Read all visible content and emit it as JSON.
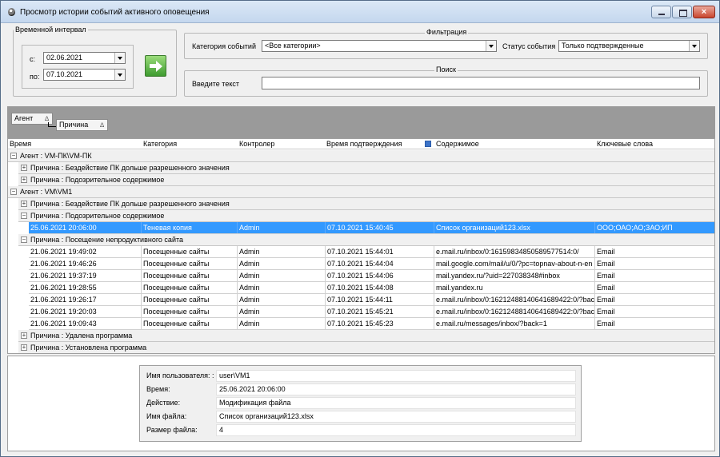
{
  "window": {
    "title": "Просмотр истории событий активного оповещения",
    "close_glyph": "×"
  },
  "interval": {
    "legend": "Временной интервал",
    "from_label": "с:",
    "from_value": "02.06.2021",
    "to_label": "по:",
    "to_value": "07.10.2021"
  },
  "filter": {
    "legend": "Фильтрация",
    "category_label": "Категория событий",
    "category_value": "<Все категории>",
    "status_label": "Статус события",
    "status_value": "Только подтвержденные"
  },
  "search": {
    "legend": "Поиск",
    "label": "Введите текст",
    "value": ""
  },
  "grouping": {
    "chips": [
      "Агент",
      "Причина"
    ],
    "sort_glyph": "∆"
  },
  "grid": {
    "columns": [
      "Время",
      "Категория",
      "Контролер",
      "Время подтверждения",
      "Содержимое",
      "Ключевые слова"
    ],
    "agents": [
      {
        "label": "Агент : VM-ПК\\VM-ПК",
        "reasons": [
          {
            "label": "Причина : Бездействие ПК дольше разрешенного значения",
            "expanded": false,
            "rows": []
          },
          {
            "label": "Причина : Подозрительное содержимое",
            "expanded": false,
            "rows": []
          }
        ]
      },
      {
        "label": "Агент : VM\\VM1",
        "reasons": [
          {
            "label": "Причина : Бездействие ПК дольше разрешенного значения",
            "expanded": false,
            "rows": []
          },
          {
            "label": "Причина : Подозрительное содержимое",
            "expanded": true,
            "rows": [
              {
                "time": "25.06.2021 20:06:00",
                "category": "Теневая копия",
                "controller": "Admin",
                "confirmed": "07.10.2021 15:40:45",
                "content": "Список организаций123.xlsx",
                "keywords": "ООО;ОАО;АО;ЗАО;ИП",
                "selected": true
              }
            ]
          },
          {
            "label": "Причина : Посещение непродуктивного сайта",
            "expanded": true,
            "rows": [
              {
                "time": "21.06.2021 19:49:02",
                "category": "Посещенные сайты",
                "controller": "Admin",
                "confirmed": "07.10.2021 15:44:01",
                "content": "e.mail.ru/inbox/0:16159834850589577514:0/",
                "keywords": "Email"
              },
              {
                "time": "21.06.2021 19:46:26",
                "category": "Посещенные сайты",
                "controller": "Admin",
                "confirmed": "07.10.2021 15:44:04",
                "content": "mail.google.com/mail/u/0/?pc=topnav-about-n-en",
                "keywords": "Email"
              },
              {
                "time": "21.06.2021 19:37:19",
                "category": "Посещенные сайты",
                "controller": "Admin",
                "confirmed": "07.10.2021 15:44:06",
                "content": "mail.yandex.ru/?uid=227038348#inbox",
                "keywords": "Email"
              },
              {
                "time": "21.06.2021 19:28:55",
                "category": "Посещенные сайты",
                "controller": "Admin",
                "confirmed": "07.10.2021 15:44:08",
                "content": "mail.yandex.ru",
                "keywords": "Email"
              },
              {
                "time": "21.06.2021 19:26:17",
                "category": "Посещенные сайты",
                "controller": "Admin",
                "confirmed": "07.10.2021 15:44:11",
                "content": "e.mail.ru/inbox/0:16212488140641689422:0/?back",
                "keywords": "Email"
              },
              {
                "time": "21.06.2021 19:20:03",
                "category": "Посещенные сайты",
                "controller": "Admin",
                "confirmed": "07.10.2021 15:45:21",
                "content": "e.mail.ru/inbox/0:16212488140641689422:0/?back",
                "keywords": "Email"
              },
              {
                "time": "21.06.2021 19:09:43",
                "category": "Посещенные сайты",
                "controller": "Admin",
                "confirmed": "07.10.2021 15:45:23",
                "content": "e.mail.ru/messages/inbox/?back=1",
                "keywords": "Email"
              }
            ]
          },
          {
            "label": "Причина : Удалена программа",
            "expanded": false,
            "rows": []
          },
          {
            "label": "Причина : Установлена программа",
            "expanded": false,
            "rows": []
          }
        ]
      }
    ]
  },
  "details": [
    {
      "label": "Имя пользователя: :",
      "value": "user\\VM1"
    },
    {
      "label": "Время:",
      "value": "25.06.2021 20:06:00"
    },
    {
      "label": "Действие:",
      "value": "Модификация файла"
    },
    {
      "label": "Имя файла:",
      "value": "Список организаций123.xlsx"
    },
    {
      "label": "Размер файла:",
      "value": "4"
    }
  ]
}
